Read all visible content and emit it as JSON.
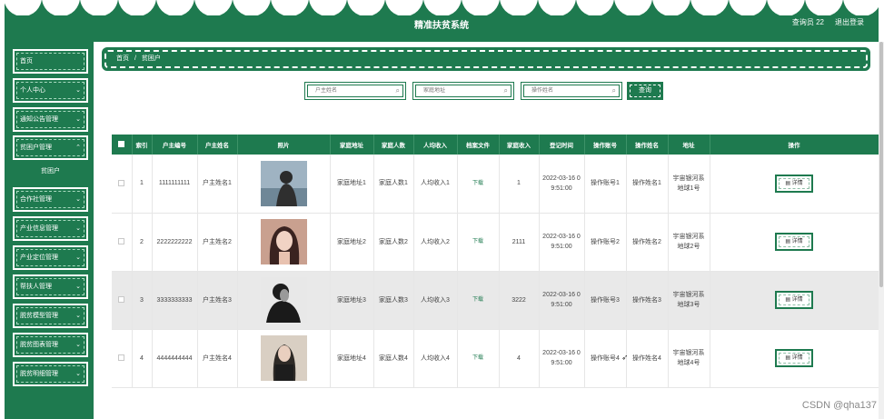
{
  "header": {
    "title": "精准扶贫系统",
    "user_label": "查询员 22",
    "logout_label": "退出登录"
  },
  "sidebar": {
    "items": [
      {
        "label": "首页",
        "chevron": false
      },
      {
        "label": "个人中心",
        "chevron": true
      },
      {
        "label": "通知公告管理",
        "chevron": true
      },
      {
        "label": "贫困户管理",
        "chevron": true
      },
      {
        "label": "合作社管理",
        "chevron": true
      },
      {
        "label": "产业信息管理",
        "chevron": true
      },
      {
        "label": "产业定位管理",
        "chevron": true
      },
      {
        "label": "帮扶人管理",
        "chevron": true
      },
      {
        "label": "脱贫模型管理",
        "chevron": true
      },
      {
        "label": "脱贫图表管理",
        "chevron": true
      },
      {
        "label": "脱贫明细管理",
        "chevron": true
      }
    ],
    "subitem": "贫困户"
  },
  "breadcrumb": {
    "home": "首页",
    "separator": "/",
    "current": "贫困户"
  },
  "search": {
    "field1_placeholder": "户主姓名",
    "field2_placeholder": "家庭地址",
    "field3_placeholder": "操作姓名",
    "button_label": "查询"
  },
  "table": {
    "headers": [
      "",
      "索引",
      "户主编号",
      "户主姓名",
      "照片",
      "家庭地址",
      "家庭人数",
      "人均收入",
      "档案文件",
      "家庭收入",
      "登记时间",
      "操作账号",
      "操作姓名",
      "地址",
      "操作"
    ],
    "rows": [
      {
        "index": "1",
        "number": "1111111111",
        "name": "户主姓名1",
        "address": "家庭地址1",
        "members": "家庭人数1",
        "income_pc": "人均收入1",
        "file": "下载",
        "income": "1",
        "time": "2022-03-16 09:51:00",
        "op_account": "操作账号1",
        "op_name": "操作姓名1",
        "location": "宇宙银河系地球1号",
        "action": "详情"
      },
      {
        "index": "2",
        "number": "2222222222",
        "name": "户主姓名2",
        "address": "家庭地址2",
        "members": "家庭人数2",
        "income_pc": "人均收入2",
        "file": "下载",
        "income": "2111",
        "time": "2022-03-16 09:51:00",
        "op_account": "操作账号2",
        "op_name": "操作姓名2",
        "location": "宇宙银河系地球2号",
        "action": "详情"
      },
      {
        "index": "3",
        "number": "3333333333",
        "name": "户主姓名3",
        "address": "家庭地址3",
        "members": "家庭人数3",
        "income_pc": "人均收入3",
        "file": "下载",
        "income": "3222",
        "time": "2022-03-16 09:51:00",
        "op_account": "操作账号3",
        "op_name": "操作姓名3",
        "location": "宇宙银河系地球3号",
        "action": "详情"
      },
      {
        "index": "4",
        "number": "4444444444",
        "name": "户主姓名4",
        "address": "家庭地址4",
        "members": "家庭人数4",
        "income_pc": "人均收入4",
        "file": "下载",
        "income": "4",
        "time": "2022-03-16 09:51:00",
        "op_account": "操作账号4",
        "op_name": "操作姓名4",
        "location": "宇宙银河系地球4号",
        "action": "详情"
      }
    ]
  },
  "watermark": "CSDN @qha137",
  "colors": {
    "primary": "#1e7a4f",
    "header_text": "#ffffff",
    "row_highlight": "#e9e9e9"
  }
}
